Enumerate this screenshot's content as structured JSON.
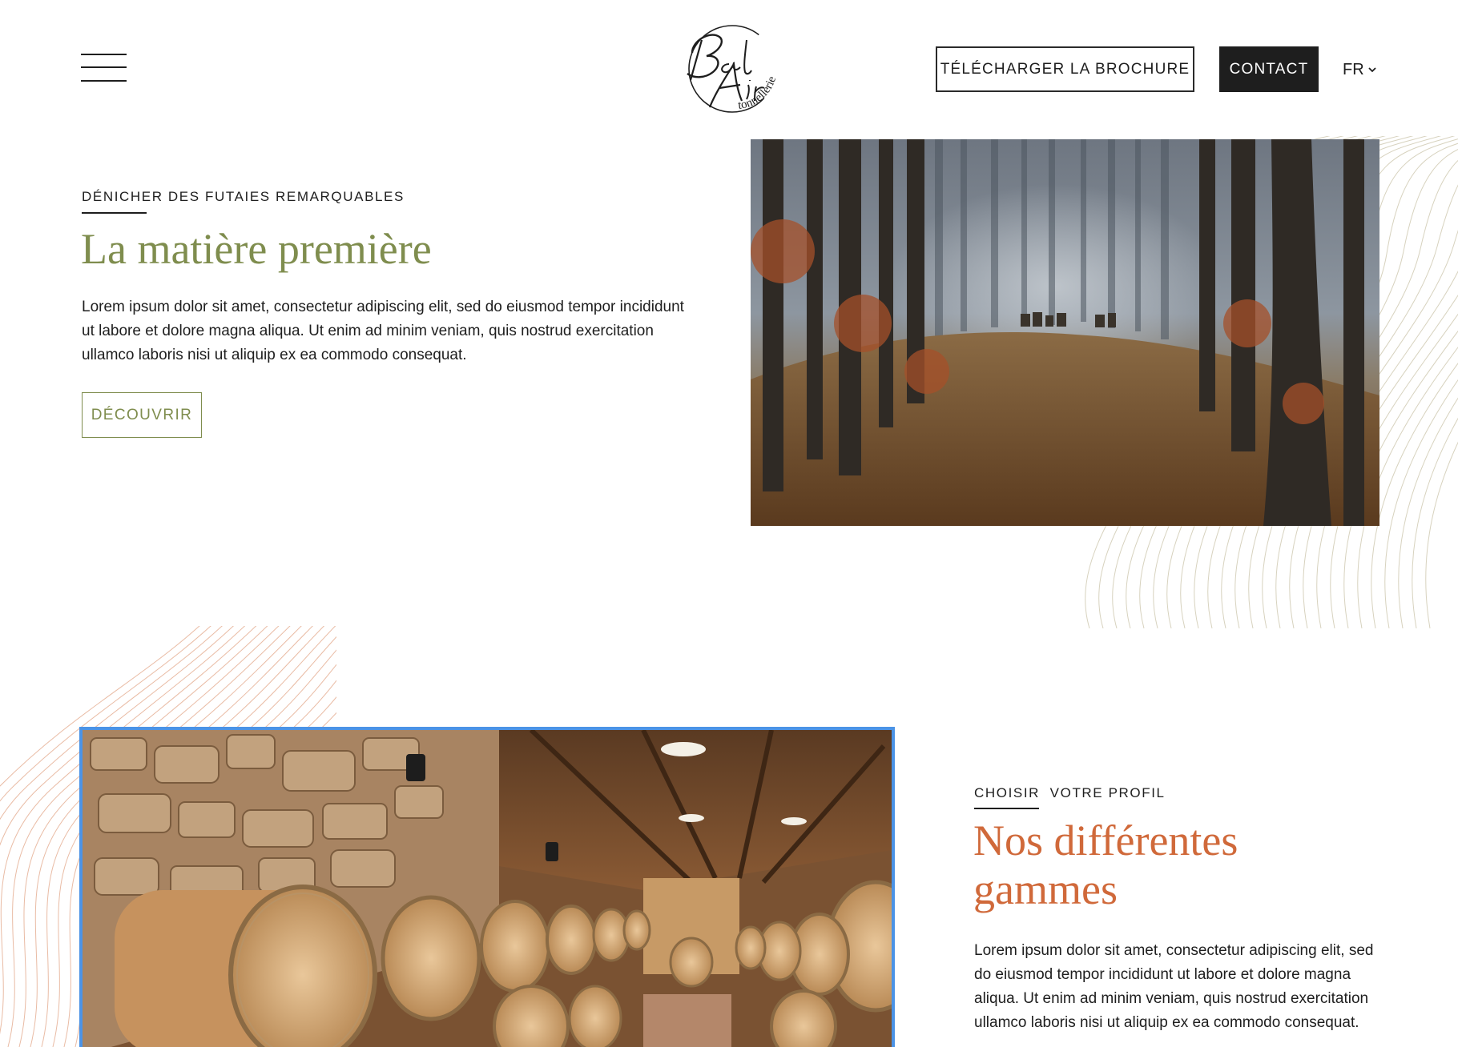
{
  "header": {
    "logo_text": "Bel Air tonnellerie",
    "brochure_label": "TÉLÉCHARGER LA BROCHURE",
    "contact_label": "CONTACT",
    "language": "FR"
  },
  "section_raw_material": {
    "eyebrow": "DÉNICHER DES FUTAIES REMARQUABLES",
    "title": "La matière première",
    "paragraph": "Lorem ipsum dolor sit amet, consectetur adipiscing elit, sed do eiusmod tempor incididunt ut labore et dolore magna aliqua. Ut enim ad minim veniam, quis nostrud exercitation ullamco laboris nisi ut aliquip ex ea commodo consequat.",
    "button_label": "DÉCOUVRIR"
  },
  "section_ranges": {
    "eyebrow": "CHOISIR  VOTRE PROFIL",
    "title": "Nos différentes gammes",
    "paragraph": "Lorem ipsum dolor sit amet, consectetur adipiscing elit, sed do eiusmod tempor incididunt ut labore et dolore magna aliqua. Ut enim ad minim veniam, quis nostrud exercitation ullamco laboris nisi ut aliquip ex ea commodo consequat."
  },
  "colors": {
    "accent_green": "#7f8d4e",
    "accent_orange": "#d0693a",
    "selection_blue": "#4b93e6",
    "dark": "#1e1e1e"
  }
}
